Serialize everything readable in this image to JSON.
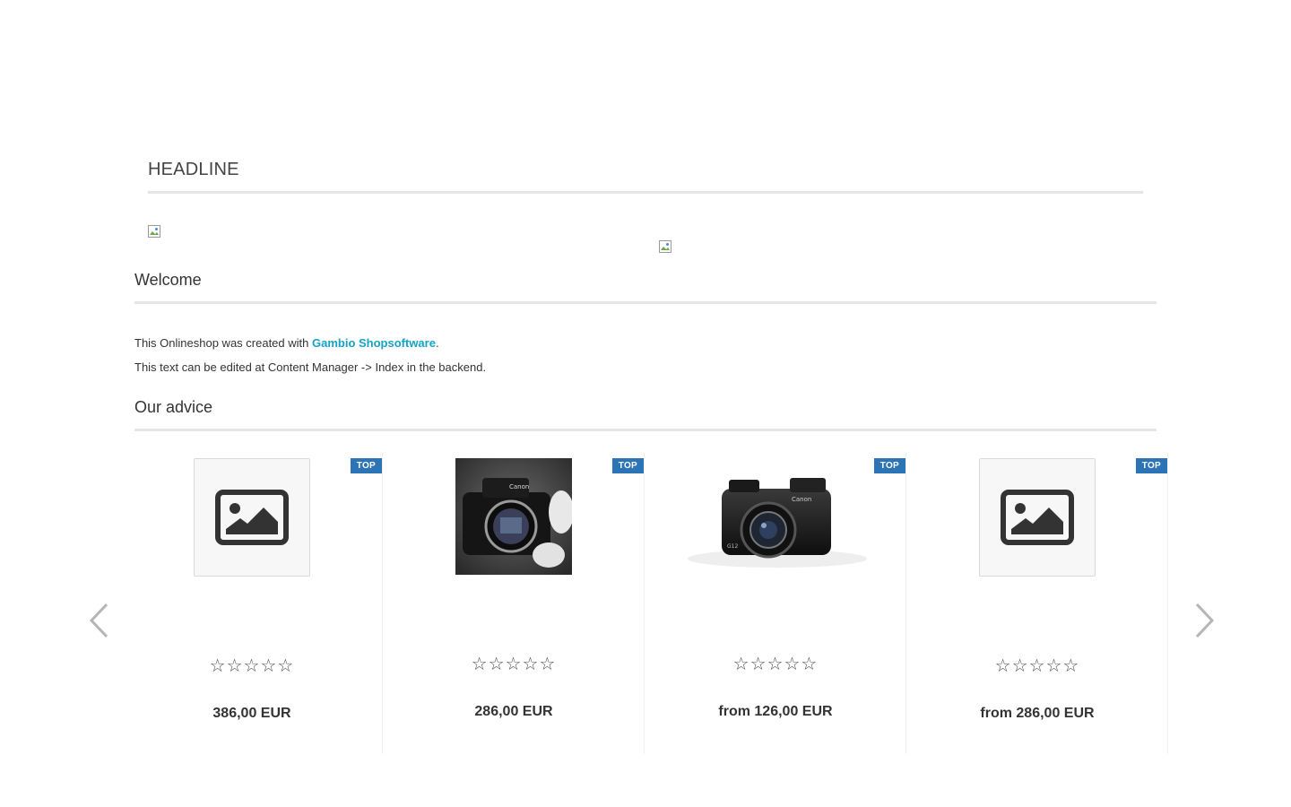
{
  "headline": "HEADLINE",
  "welcome": {
    "title": "Welcome",
    "line1_prefix": "This Onlineshop was created with ",
    "line1_link": "Gambio Shopsoftware",
    "line1_suffix": ".",
    "line2": "This text can be edited at Content Manager -> Index in the backend."
  },
  "advice": {
    "title": "Our advice",
    "products": [
      {
        "badge": "TOP",
        "image": "placeholder-image-icon",
        "rating": 0,
        "stars": "☆☆☆☆☆",
        "price": "386,00 EUR"
      },
      {
        "badge": "TOP",
        "image": "camera-body-photo",
        "rating": 0,
        "stars": "☆☆☆☆☆",
        "price": "286,00 EUR"
      },
      {
        "badge": "TOP",
        "image": "compact-camera-photo",
        "rating": 0,
        "stars": "☆☆☆☆☆",
        "price": "from 126,00 EUR"
      },
      {
        "badge": "TOP",
        "image": "placeholder-image-icon",
        "rating": 0,
        "stars": "☆☆☆☆☆",
        "price": "from 286,00 EUR"
      }
    ]
  },
  "icons": {
    "prev": "chevron-left-icon",
    "next": "chevron-right-icon",
    "broken_image": "broken-image-icon"
  },
  "colors": {
    "link": "#16a2c4",
    "badge": "#2c74b5"
  }
}
